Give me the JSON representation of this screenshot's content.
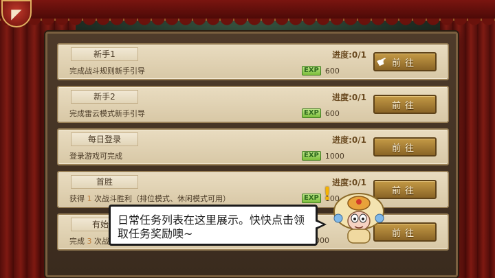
{
  "corner_icon": "back-arrow-icon",
  "tasks": [
    {
      "title": "新手1",
      "desc": "完成战斗规则新手引导",
      "progress": "进度:0/1",
      "exp_label": "EXP",
      "exp": "600",
      "button": "前往"
    },
    {
      "title": "新手2",
      "desc": "完成雷云模式新手引导",
      "progress": "进度:0/1",
      "exp_label": "EXP",
      "exp": "600",
      "button": "前往"
    },
    {
      "title": "每日登录",
      "desc": "登录游戏可完成",
      "progress": "进度:0/1",
      "exp_label": "EXP",
      "exp": "1000",
      "button": "前往"
    },
    {
      "title": "首胜",
      "desc_prefix": "获得",
      "desc_num": "1",
      "desc_suffix": "次战斗胜利（排位模式、休闲模式可用）",
      "progress": "进度:0/1",
      "exp_label": "EXP",
      "exp": "100",
      "button": "前往"
    },
    {
      "title": "有始有",
      "desc_prefix": "完成",
      "desc_num": "3",
      "desc_suffix": "次战",
      "progress": "",
      "exp_label": "",
      "exp": "1000",
      "button": "前往"
    }
  ],
  "tip": {
    "text": "日常任务列表在这里展示。快快点击领取任务奖励噢~"
  },
  "colors": {
    "panel_bg": "#4e3b2a",
    "row_bg": "#e2d3b3",
    "button_bg": "#a97e36",
    "exp_green": "#7bbd3a",
    "curtain_red": "#8a1a12"
  }
}
